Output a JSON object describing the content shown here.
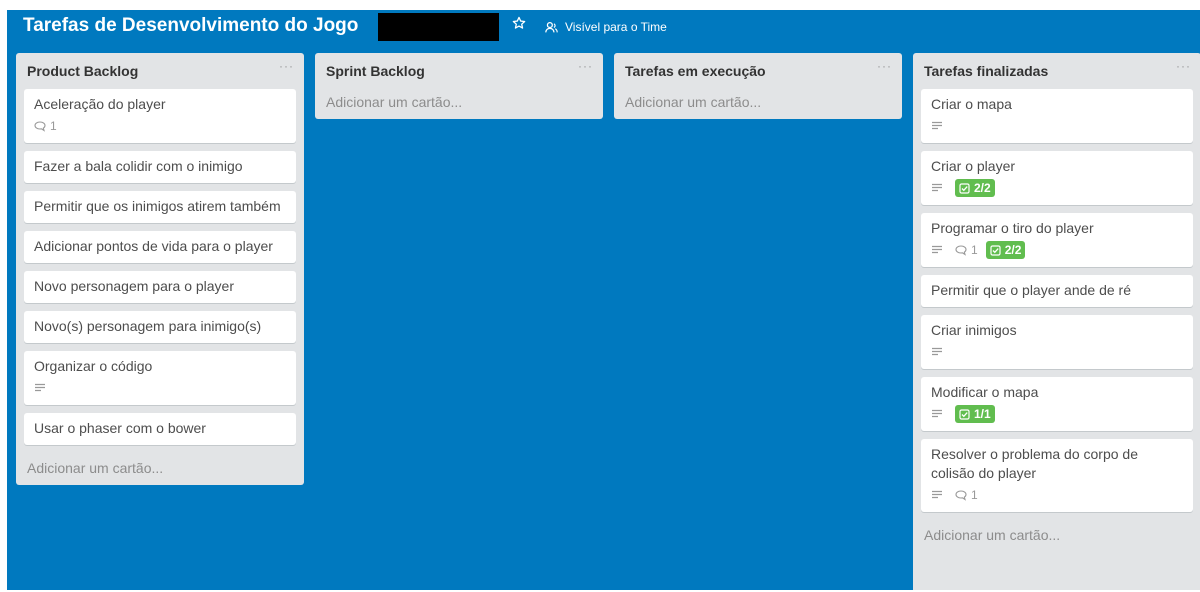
{
  "board": {
    "title": "Tarefas de Desenvolvimento do Jogo",
    "visibility_label": "Visível para o Time"
  },
  "lists": [
    {
      "title": "Product Backlog",
      "menu": "···",
      "add_label": "Adicionar um cartão...",
      "cards": [
        {
          "title": "Aceleração do player",
          "comments": "1"
        },
        {
          "title": "Fazer a bala colidir com o inimigo"
        },
        {
          "title": "Permitir que os inimigos atirem também"
        },
        {
          "title": "Adicionar pontos de vida para o player"
        },
        {
          "title": "Novo personagem para o player"
        },
        {
          "title": "Novo(s) personagem para inimigo(s)"
        },
        {
          "title": "Organizar o código",
          "description": true
        },
        {
          "title": "Usar o phaser com o bower"
        }
      ]
    },
    {
      "title": "Sprint Backlog",
      "menu": "···",
      "add_label": "Adicionar um cartão...",
      "cards": []
    },
    {
      "title": "Tarefas em execução",
      "menu": "···",
      "add_label": "Adicionar um cartão...",
      "cards": []
    },
    {
      "title": "Tarefas finalizadas",
      "menu": "···",
      "add_label": "Adicionar um cartão...",
      "cards": [
        {
          "title": "Criar o mapa",
          "description": true
        },
        {
          "title": "Criar o player",
          "description": true,
          "checklist": "2/2"
        },
        {
          "title": "Programar o tiro do player",
          "description": true,
          "comments": "1",
          "checklist": "2/2"
        },
        {
          "title": "Permitir que o player ande de ré"
        },
        {
          "title": "Criar inimigos",
          "description": true
        },
        {
          "title": "Modificar o mapa",
          "description": true,
          "checklist": "1/1"
        },
        {
          "title": "Resolver o problema do corpo de colisão do player",
          "description": true,
          "comments": "1"
        }
      ]
    }
  ],
  "colors": {
    "board_bg": "#0079bf",
    "list_bg": "#e2e4e6",
    "checklist_complete": "#61bd4f"
  },
  "icons": {
    "star": "star-icon",
    "visibility": "team-icon",
    "comment": "comment-icon",
    "description": "description-icon",
    "checklist": "checklist-icon"
  }
}
